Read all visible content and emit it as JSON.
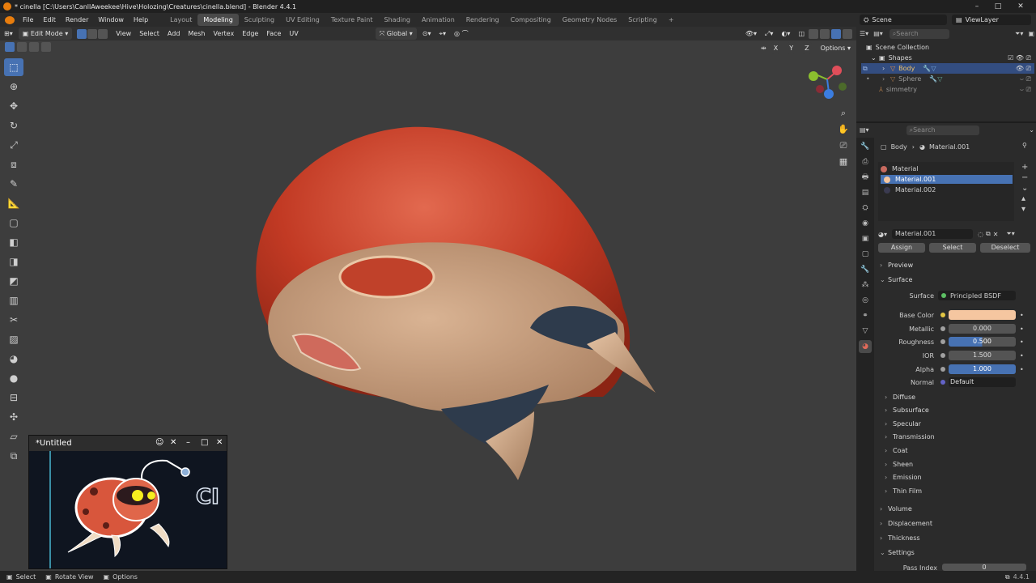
{
  "window": {
    "title": "* cinella [C:\\Users\\CanllAweekee\\Hive\\Holozing\\Creatures\\cinella.blend] - Blender 4.4.1",
    "controls": [
      "–",
      "□",
      "✕"
    ]
  },
  "menubar": {
    "menus": [
      "File",
      "Edit",
      "Render",
      "Window",
      "Help"
    ],
    "workspaces": [
      "Layout",
      "Modeling",
      "Sculpting",
      "UV Editing",
      "Texture Paint",
      "Shading",
      "Animation",
      "Rendering",
      "Compositing",
      "Geometry Nodes",
      "Scripting"
    ],
    "active_workspace": "Modeling",
    "add_tab": "+",
    "scene": "Scene",
    "view_layer": "ViewLayer"
  },
  "viewport_header": {
    "mode": "Edit Mode",
    "menus": [
      "View",
      "Select",
      "Add",
      "Mesh",
      "Vertex",
      "Edge",
      "Face",
      "UV"
    ],
    "orientation": "Global",
    "options": "Options",
    "axes": [
      "X",
      "Y",
      "Z"
    ]
  },
  "outliner": {
    "search_placeholder": "Search",
    "scene_collection": "Scene Collection",
    "items": [
      {
        "label": "Shapes",
        "level": 1
      },
      {
        "label": "Body",
        "level": 2,
        "selected": true
      },
      {
        "label": "Sphere",
        "level": 2
      },
      {
        "label": "simmetry",
        "level": 2
      }
    ]
  },
  "properties": {
    "search_placeholder": "Search",
    "breadcrumb": [
      "Body",
      "Material.001"
    ],
    "slots": [
      "Material",
      "Material.001",
      "Material.002"
    ],
    "active_slot": "Material.001",
    "material_name": "Material.001",
    "buttons": [
      "Assign",
      "Select",
      "Deselect"
    ],
    "panels": {
      "preview": "Preview",
      "surface": "Surface"
    },
    "surface": {
      "surface_label": "Surface",
      "surface_value": "Principled BSDF",
      "fields": [
        {
          "label": "Base Color",
          "value": "",
          "kind": "color"
        },
        {
          "label": "Metallic",
          "value": "0.000",
          "kind": "plain"
        },
        {
          "label": "Roughness",
          "value": "0.500",
          "kind": "blue"
        },
        {
          "label": "IOR",
          "value": "1.500",
          "kind": "plain"
        },
        {
          "label": "Alpha",
          "value": "1.000",
          "kind": "blue"
        },
        {
          "label": "Normal",
          "value": "Default",
          "kind": "dark"
        }
      ]
    },
    "subpanels": [
      "Diffuse",
      "Subsurface",
      "Specular",
      "Transmission",
      "Coat",
      "Sheen",
      "Emission",
      "Thin Film"
    ],
    "panels_bottom": [
      "Volume",
      "Displacement",
      "Thickness",
      "Settings"
    ],
    "pass_index_label": "Pass Index",
    "pass_index_value": "0"
  },
  "untitled_window": {
    "title": "*Untitled",
    "logo_text": "CI"
  },
  "statusbar": {
    "items": [
      "Select",
      "Rotate View",
      "Options"
    ],
    "version": "4.4.1"
  },
  "colors": {
    "accent": "#4772b3",
    "base_color": "#f5c6a0",
    "shell_red": "#c23a24",
    "skin": "#c9a07f",
    "beak_dark": "#2e3b4c"
  }
}
